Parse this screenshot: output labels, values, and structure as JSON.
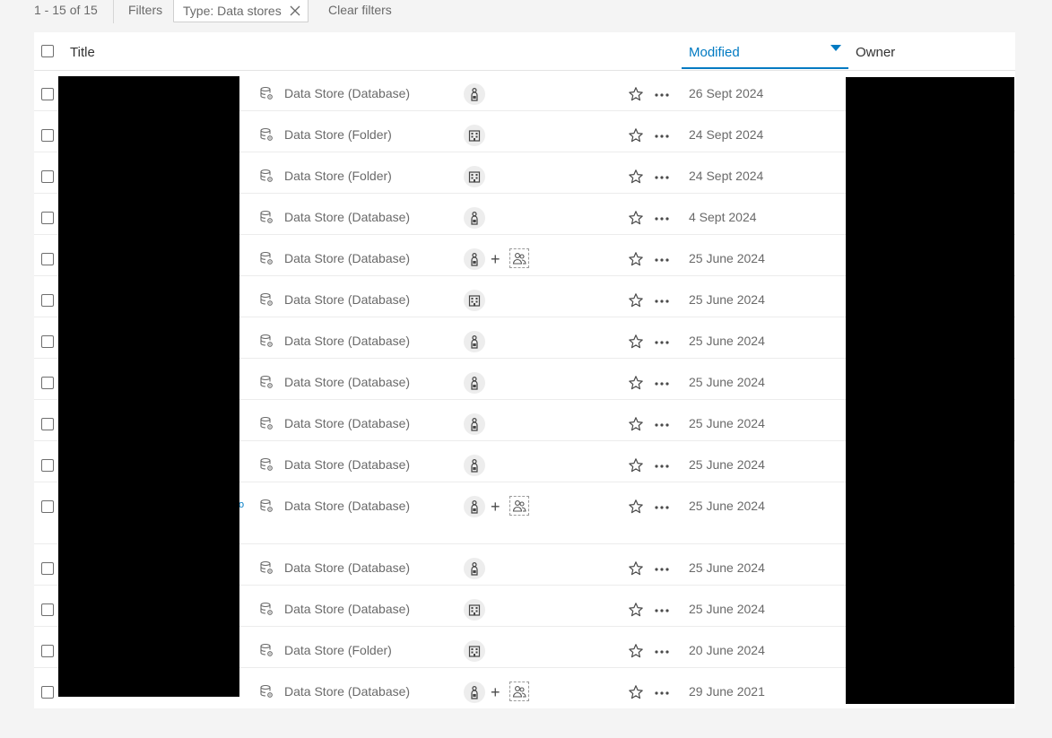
{
  "filter_bar": {
    "count": "1 - 15 of 15",
    "filters_label": "Filters",
    "chip_label": "Type: Data stores",
    "clear_label": "Clear filters"
  },
  "table": {
    "columns": {
      "title": "Title",
      "modified": "Modified",
      "owner": "Owner"
    },
    "rows": [
      {
        "type": "Data Store (Database)",
        "type_icon": "database-icon",
        "sharing": "owner",
        "modified": "26 Sept 2024"
      },
      {
        "type": "Data Store (Folder)",
        "type_icon": "database-icon",
        "sharing": "organization",
        "modified": "24 Sept 2024"
      },
      {
        "type": "Data Store (Folder)",
        "type_icon": "database-icon",
        "sharing": "organization",
        "modified": "24 Sept 2024"
      },
      {
        "type": "Data Store (Database)",
        "type_icon": "database-icon",
        "sharing": "owner",
        "modified": "4 Sept 2024"
      },
      {
        "type": "Data Store (Database)",
        "type_icon": "database-icon",
        "sharing": "owner+groups",
        "modified": "25 June 2024"
      },
      {
        "type": "Data Store (Database)",
        "type_icon": "database-icon",
        "sharing": "organization",
        "modified": "25 June 2024"
      },
      {
        "type": "Data Store (Database)",
        "type_icon": "database-icon",
        "sharing": "owner",
        "modified": "25 June 2024"
      },
      {
        "type": "Data Store (Database)",
        "type_icon": "database-icon",
        "sharing": "owner",
        "modified": "25 June 2024"
      },
      {
        "type": "Data Store (Database)",
        "type_icon": "database-icon",
        "sharing": "owner",
        "modified": "25 June 2024"
      },
      {
        "type": "Data Store (Database)",
        "type_icon": "database-icon",
        "sharing": "owner",
        "modified": "25 June 2024"
      },
      {
        "type": "Data Store (Database)",
        "type_icon": "database-icon",
        "sharing": "owner+groups",
        "modified": "25 June 2024"
      },
      {
        "type": "Data Store (Database)",
        "type_icon": "database-icon",
        "sharing": "owner",
        "modified": "25 June 2024"
      },
      {
        "type": "Data Store (Database)",
        "type_icon": "database-icon",
        "sharing": "organization",
        "modified": "25 June 2024"
      },
      {
        "type": "Data Store (Folder)",
        "type_icon": "database-icon",
        "sharing": "organization",
        "modified": "20 June 2024"
      },
      {
        "type": "Data Store (Database)",
        "type_icon": "database-icon",
        "sharing": "owner+groups",
        "modified": "29 June 2021"
      }
    ]
  },
  "icons": {
    "owner": "person-lock-icon",
    "organization": "building-icon",
    "groups": "group-icon",
    "favorite": "star-icon",
    "more": "more-options-icon",
    "close": "close-icon",
    "sort": "sort-descending-icon"
  },
  "colors": {
    "accent": "#007ac2",
    "redaction": "#000000"
  }
}
